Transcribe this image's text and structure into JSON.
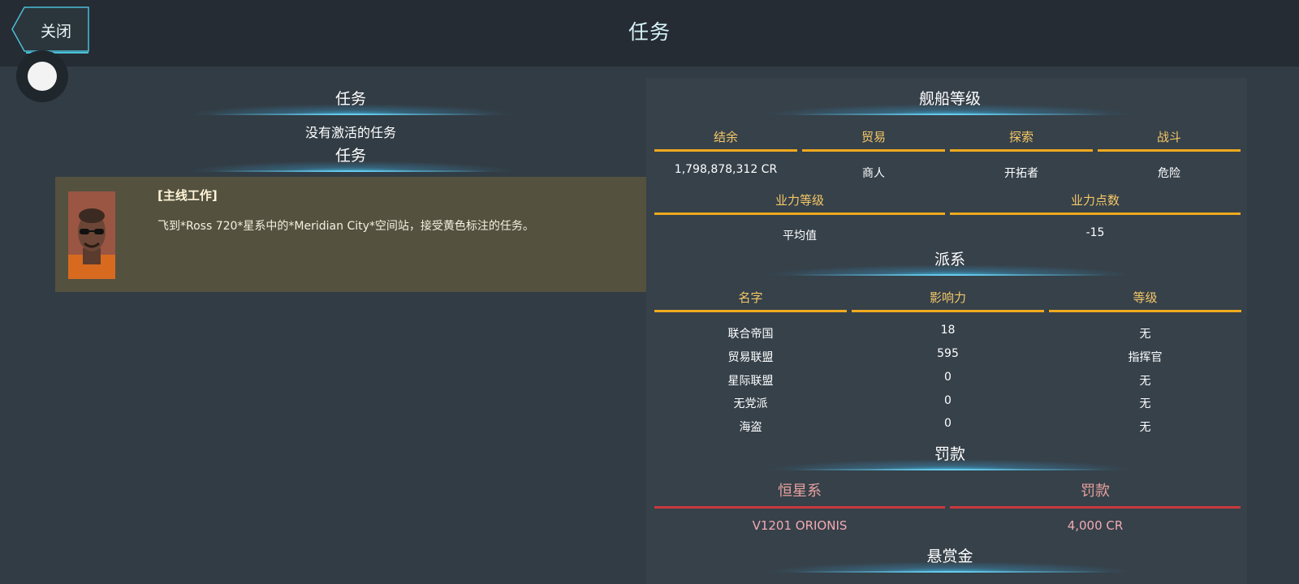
{
  "header": {
    "title": "任务",
    "close_label": "关闭"
  },
  "missions": {
    "header": "任务",
    "no_active": "没有激活的任务",
    "header2": "任务",
    "card": {
      "title": "[主线工作]",
      "description": "飞到*Ross 720*星系中的*Meridian City*空间站，接受黄色标注的任务。"
    }
  },
  "ship_rank": {
    "header": "舰船等级",
    "columns": [
      "结余",
      "贸易",
      "探索",
      "战斗"
    ],
    "values": [
      "1,798,878,312 CR",
      "商人",
      "开拓者",
      "危险"
    ]
  },
  "reputation": {
    "columns": [
      "业力等级",
      "业力点数"
    ],
    "values": [
      "平均值",
      "-15"
    ]
  },
  "factions": {
    "header": "派系",
    "columns": [
      "名字",
      "影响力",
      "等级"
    ],
    "rows": [
      [
        "联合帝国",
        "18",
        "无"
      ],
      [
        "贸易联盟",
        "595",
        "指挥官"
      ],
      [
        "星际联盟",
        "0",
        "无"
      ],
      [
        "无党派",
        "0",
        "无"
      ],
      [
        "海盗",
        "0",
        "无"
      ]
    ]
  },
  "fines": {
    "header": "罚款",
    "columns": [
      "恒星系",
      "罚款"
    ],
    "values": [
      "V1201 ORIONIS",
      "4,000 CR"
    ]
  },
  "bounty": {
    "header": "悬赏金"
  },
  "icons": {
    "close": "back-arrow-icon",
    "toggle": "toggle-icon",
    "portrait": "pilot-portrait-icon"
  }
}
